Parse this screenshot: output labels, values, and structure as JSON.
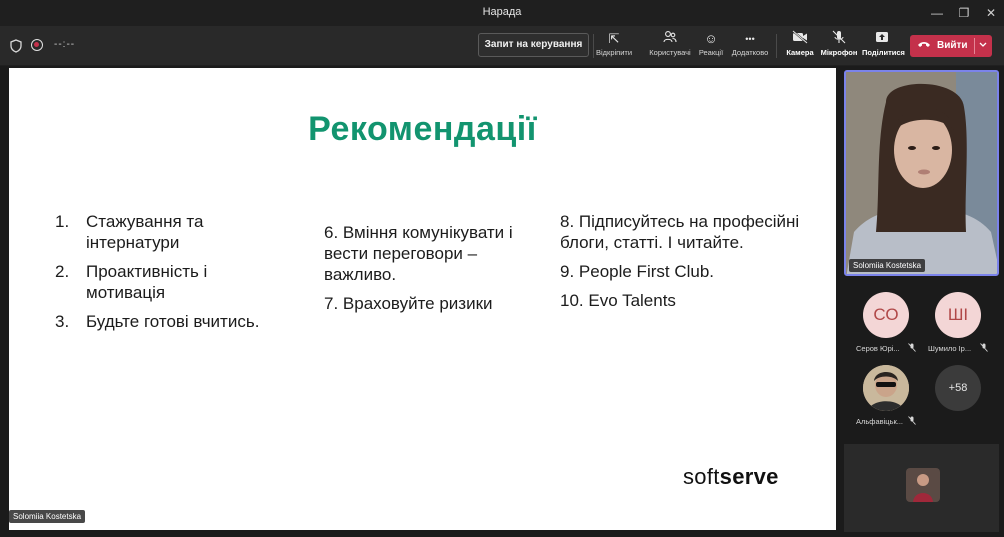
{
  "window": {
    "title": "Нарада",
    "minimize_icon": "—",
    "restore_icon": "❐",
    "close_icon": "✕"
  },
  "toolbar": {
    "timer": "--:--",
    "request_control_label": "Запит на керування",
    "tools": [
      {
        "icon": "pop-out-icon",
        "glyph": "⇱",
        "label": "Відкріпити"
      },
      {
        "icon": "people-icon",
        "glyph": "👥",
        "label": "Користувачі"
      },
      {
        "icon": "reactions-icon",
        "glyph": "☺",
        "label": "Реакції"
      },
      {
        "icon": "more-icon",
        "glyph": "•••",
        "label": "Додатково"
      }
    ],
    "media": [
      {
        "icon": "camera-off-icon",
        "glyph": "📹",
        "label": "Камера"
      },
      {
        "icon": "mic-off-icon",
        "glyph": "🎙",
        "label": "Мікрофон"
      },
      {
        "icon": "share-icon",
        "glyph": "⬆",
        "label": "Поділитися"
      }
    ],
    "leave_label": "Вийти",
    "accent": "#c4314b"
  },
  "slide": {
    "title": "Рекомендації",
    "title_color": "#12946f",
    "column1": [
      {
        "num": "1.",
        "text": "Стажування та інтернатури"
      },
      {
        "num": "2.",
        "text": "Проактивність і мотивація"
      },
      {
        "num": "3.",
        "text": "Будьте готові вчитись."
      }
    ],
    "column2": [
      "6. Вміння комунікувати і вести переговори – важливо.",
      "7. Враховуйте ризики"
    ],
    "column3": [
      "8. Підписуйтесь на професійні блоги, статті. І читайте.",
      "9. People First Club.",
      "10. Evo Talents"
    ],
    "logo_light": "soft",
    "logo_bold": "serve",
    "presenter_tag": "Solomiia Kostetska"
  },
  "participants": {
    "speaker_name": "Solomiia Kostetska",
    "list": [
      {
        "initials": "СО",
        "name": "Серов Юрі...",
        "bg": "#f3d6d6",
        "fg": "#b04848"
      },
      {
        "initials": "ШІ",
        "name": "Шумило Ір...",
        "bg": "#f3d6d6",
        "fg": "#b04848"
      },
      {
        "initials": "",
        "name": "Альфавіцьк...",
        "bg": "#c7b49a",
        "fg": "#333"
      }
    ],
    "overflow": "+58"
  }
}
